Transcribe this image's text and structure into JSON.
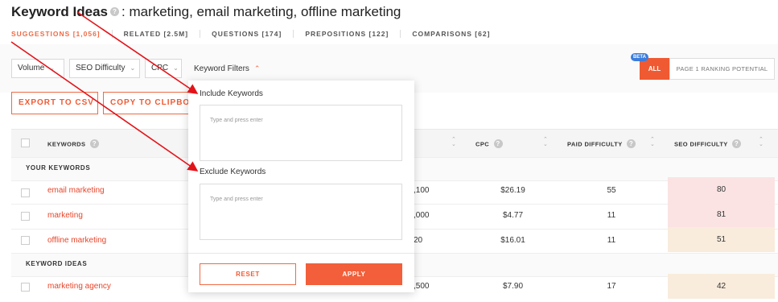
{
  "header": {
    "title_bold": "Keyword Ideas",
    "title_rest": ": marketing, email marketing, offline marketing"
  },
  "tabs": [
    {
      "label": "SUGGESTIONS [1,056]",
      "active": true
    },
    {
      "label": "RELATED [2.5M]"
    },
    {
      "label": "QUESTIONS [174]"
    },
    {
      "label": "PREPOSITIONS [122]"
    },
    {
      "label": "COMPARISONS [62]"
    }
  ],
  "filters": {
    "volume": "Volume",
    "seo_difficulty": "SEO Difficulty",
    "cpc": "CPC",
    "keyword_filters": "Keyword Filters",
    "beta": "BETA",
    "all": "ALL",
    "page1": "PAGE 1 RANKING POTENTIAL"
  },
  "actions": {
    "export": "EXPORT TO CSV",
    "copy": "COPY TO CLIPBOARD"
  },
  "table": {
    "headers": {
      "keywords": "KEYWORDS",
      "cpc": "CPC",
      "paid": "PAID DIFFICULTY",
      "seo": "SEO DIFFICULTY"
    },
    "section_yours": "YOUR KEYWORDS",
    "section_ideas": "KEYWORD IDEAS",
    "rows": [
      {
        "keyword": "email marketing",
        "volume": ",100",
        "cpc": "$26.19",
        "paid": "55",
        "seo": "80"
      },
      {
        "keyword": "marketing",
        "volume": ",000",
        "cpc": "$4.77",
        "paid": "11",
        "seo": "81"
      },
      {
        "keyword": "offline marketing",
        "volume": "20",
        "cpc": "$16.01",
        "paid": "11",
        "seo": "51"
      },
      {
        "keyword": "marketing agency",
        "volume": ",500",
        "cpc": "$7.90",
        "paid": "17",
        "seo": "42"
      }
    ]
  },
  "popup": {
    "include_label": "Include Keywords",
    "include_placeholder": "Type and press enter",
    "exclude_label": "Exclude Keywords",
    "exclude_placeholder": "Type and press enter",
    "reset": "RESET",
    "apply": "APPLY"
  },
  "colors": {
    "accent": "#f05a32",
    "seo_high": "#fbe3e3",
    "seo_mid": "#f9ecdc",
    "annotation_arrow": "#e2141a"
  }
}
